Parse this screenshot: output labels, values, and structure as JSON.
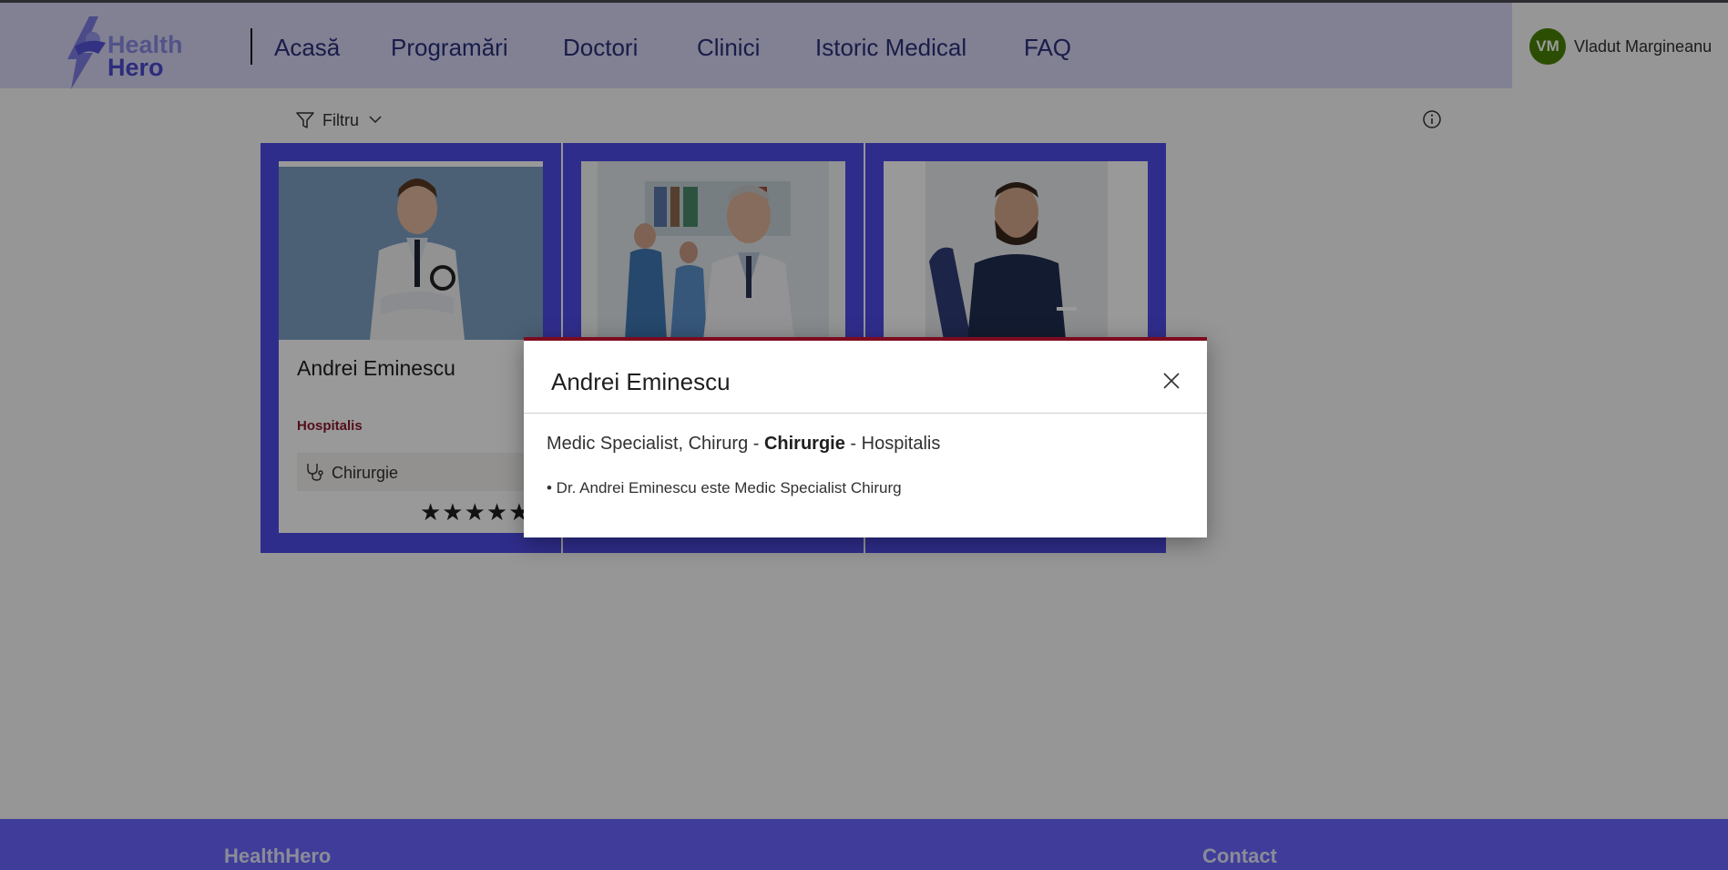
{
  "app": {
    "brand_line1": "Health",
    "brand_line2": "Hero"
  },
  "nav": {
    "items": [
      {
        "label": "Acasă"
      },
      {
        "label": "Programări"
      },
      {
        "label": "Doctori"
      },
      {
        "label": "Clinici"
      },
      {
        "label": "Istoric Medical"
      },
      {
        "label": "FAQ"
      }
    ]
  },
  "user": {
    "initials": "VM",
    "name": "Vladut Margineanu",
    "avatar_color": "#498205"
  },
  "filter": {
    "label": "Filtru",
    "icon": "filter-icon",
    "info_icon": "info-icon"
  },
  "doctors": [
    {
      "name": "Andrei Eminescu",
      "clinic": "Hospitalis",
      "specialty": "Chirurgie",
      "rating": "★★★★★"
    },
    {
      "name": "",
      "clinic": "",
      "specialty": "",
      "rating": ""
    },
    {
      "name": "",
      "clinic": "",
      "specialty": "",
      "rating": ""
    }
  ],
  "dialog": {
    "title": "Andrei Eminescu",
    "sub_prefix": "Medic Specialist, Chirurg - ",
    "sub_bold": "Chirurgie",
    "sub_suffix": " - Hospitalis",
    "description": "• Dr. Andrei Eminescu este Medic Specialist Chirurg",
    "accent_color": "#7d0b1f"
  },
  "footer": {
    "brand": "HealthHero",
    "contact": "Contact",
    "bg_color": "#6a66ff"
  },
  "colors": {
    "card_border": "#4f4ce8",
    "nav_bg": "#d7d7f6",
    "nav_text": "#2b2f7a",
    "clinic_text": "#8b1a2c"
  }
}
